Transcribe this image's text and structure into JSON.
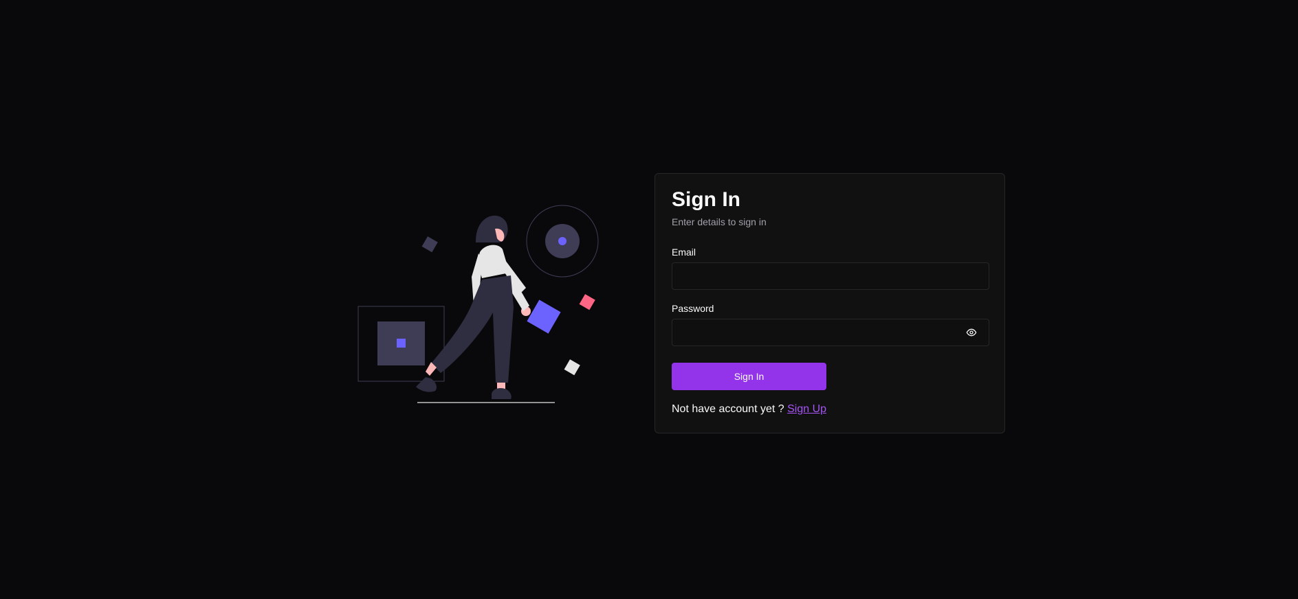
{
  "form": {
    "title": "Sign In",
    "subtitle": "Enter details to sign in",
    "email_label": "Email",
    "email_value": "",
    "password_label": "Password",
    "password_value": "",
    "submit_label": "Sign In",
    "footer_prompt": "Not have account yet ?",
    "signup_label": "Sign Up"
  },
  "icons": {
    "password_toggle": "eye-icon"
  },
  "colors": {
    "background": "#09090b",
    "card": "#111111",
    "accent": "#9333ea",
    "link": "#a855f7",
    "illustration_accent": "#6c63ff",
    "illustration_pink": "#ff6584"
  }
}
